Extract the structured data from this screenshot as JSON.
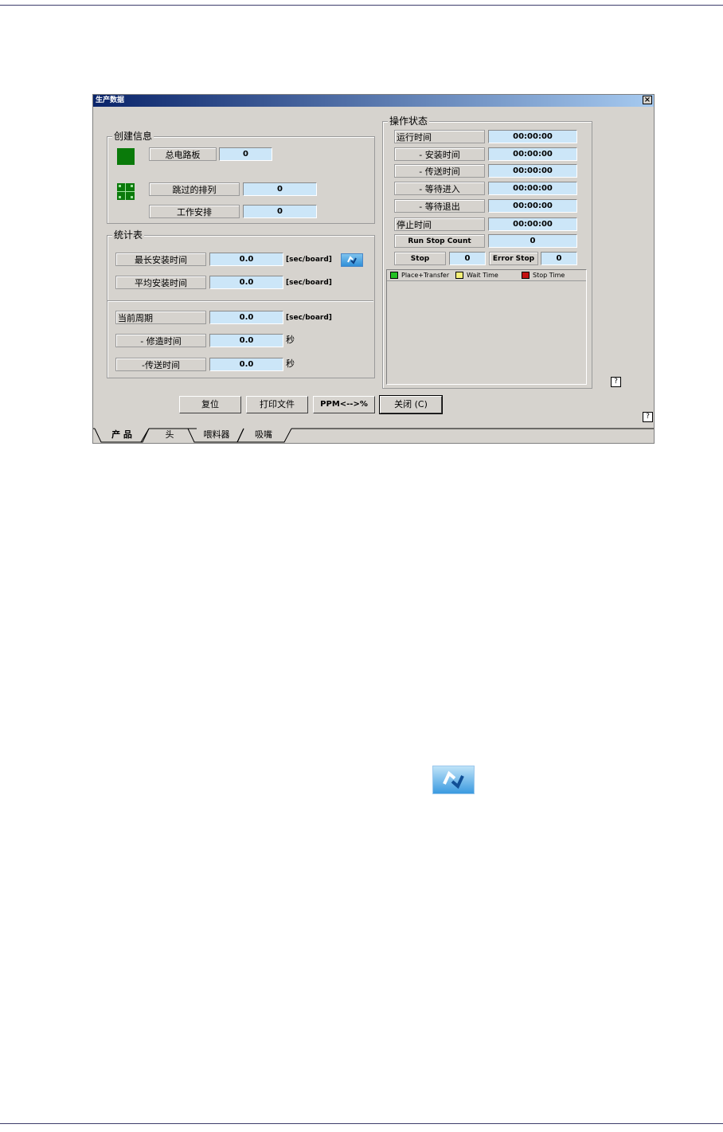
{
  "window": {
    "title": "生产数据",
    "close_glyph": "×"
  },
  "creation": {
    "title": "创建信息",
    "total_boards_label": "总电路板",
    "total_boards_value": "0",
    "skipped_label": "跳过的排列",
    "skipped_value": "0",
    "job_label": "工作安排",
    "job_value": "0"
  },
  "stats": {
    "title": "统计表",
    "max_label": "最长安装时间",
    "max_value": "0.0",
    "max_unit": "[sec/board]",
    "avg_label": "平均安装时间",
    "avg_value": "0.0",
    "avg_unit": "[sec/board]",
    "cycle_label": "当前周期",
    "cycle_value": "0.0",
    "cycle_unit": "[sec/board]",
    "repair_label": "- 修造时间",
    "repair_value": "0.0",
    "repair_unit": "秒",
    "transfer_label": "-传送时间",
    "transfer_value": "0.0",
    "transfer_unit": "秒"
  },
  "ops": {
    "title": "操作状态",
    "run_label": "运行时间",
    "run_value": "00:00:00",
    "mount_label": "- 安装时间",
    "mount_value": "00:00:00",
    "transfer_label": "- 传送时间",
    "transfer_value": "00:00:00",
    "wait_in_label": "- 等待进入",
    "wait_in_value": "00:00:00",
    "wait_out_label": "- 等待退出",
    "wait_out_value": "00:00:00",
    "stop_time_label": "停止时间",
    "stop_time_value": "00:00:00",
    "run_stop_label": "Run Stop Count",
    "run_stop_value": "0",
    "stop_label": "Stop",
    "stop_value": "0",
    "error_stop_label": "Error Stop",
    "error_stop_value": "0",
    "legend": [
      {
        "label": "Place+Transfer",
        "color": "#22c122"
      },
      {
        "label": "Wait Time",
        "color": "#f5f078"
      },
      {
        "label": "Stop Time",
        "color": "#c41010"
      }
    ]
  },
  "buttons": {
    "reset": "复位",
    "print": "打印文件",
    "ppm": "PPM<-->%",
    "close": "关闭 (C)"
  },
  "help_glyph": "?",
  "tabs": [
    "产 品",
    "头",
    "喂料器",
    "吸嘴"
  ]
}
